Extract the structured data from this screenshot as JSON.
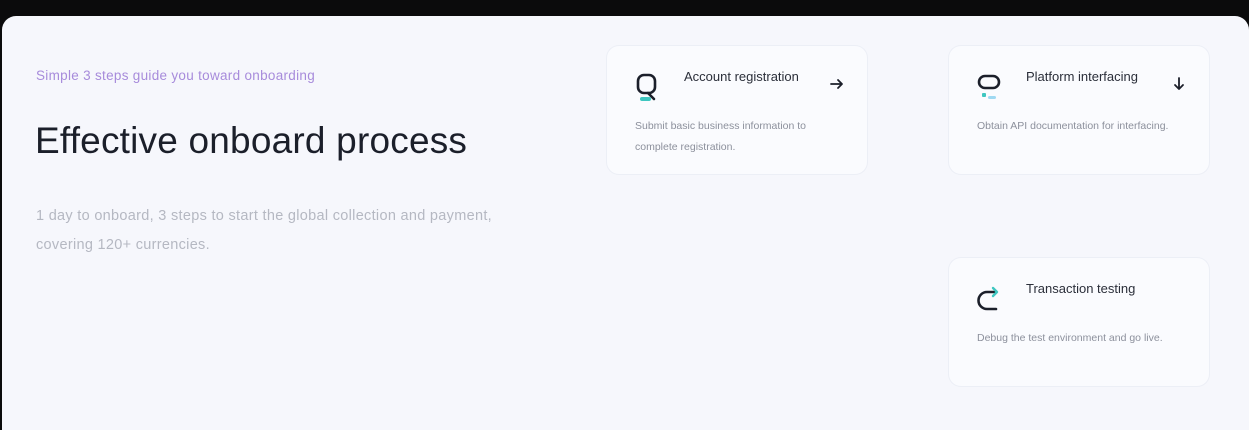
{
  "hero": {
    "eyebrow": "Simple 3 steps guide you toward onboarding",
    "title": "Effective onboard process",
    "description": "1 day to onboard, 3 steps to start the global collection and payment, covering 120+ currencies."
  },
  "steps": [
    {
      "title": "Account registration",
      "text": "Submit basic business information to complete registration.",
      "icon": "account-icon",
      "arrow": "arrow-right-icon"
    },
    {
      "title": "Platform interfacing",
      "text": "Obtain API documentation for interfacing.",
      "icon": "platform-icon",
      "arrow": "arrow-down-icon"
    },
    {
      "title": "Transaction testing",
      "text": "Debug the test environment and go live.",
      "icon": "refresh-icon"
    }
  ],
  "colors": {
    "background": "#0b0b0c",
    "panel": "#f6f7fc",
    "accent_purple": "#a78bdb",
    "accent_teal": "#3ec6c0",
    "heading": "#1b1f2a"
  }
}
